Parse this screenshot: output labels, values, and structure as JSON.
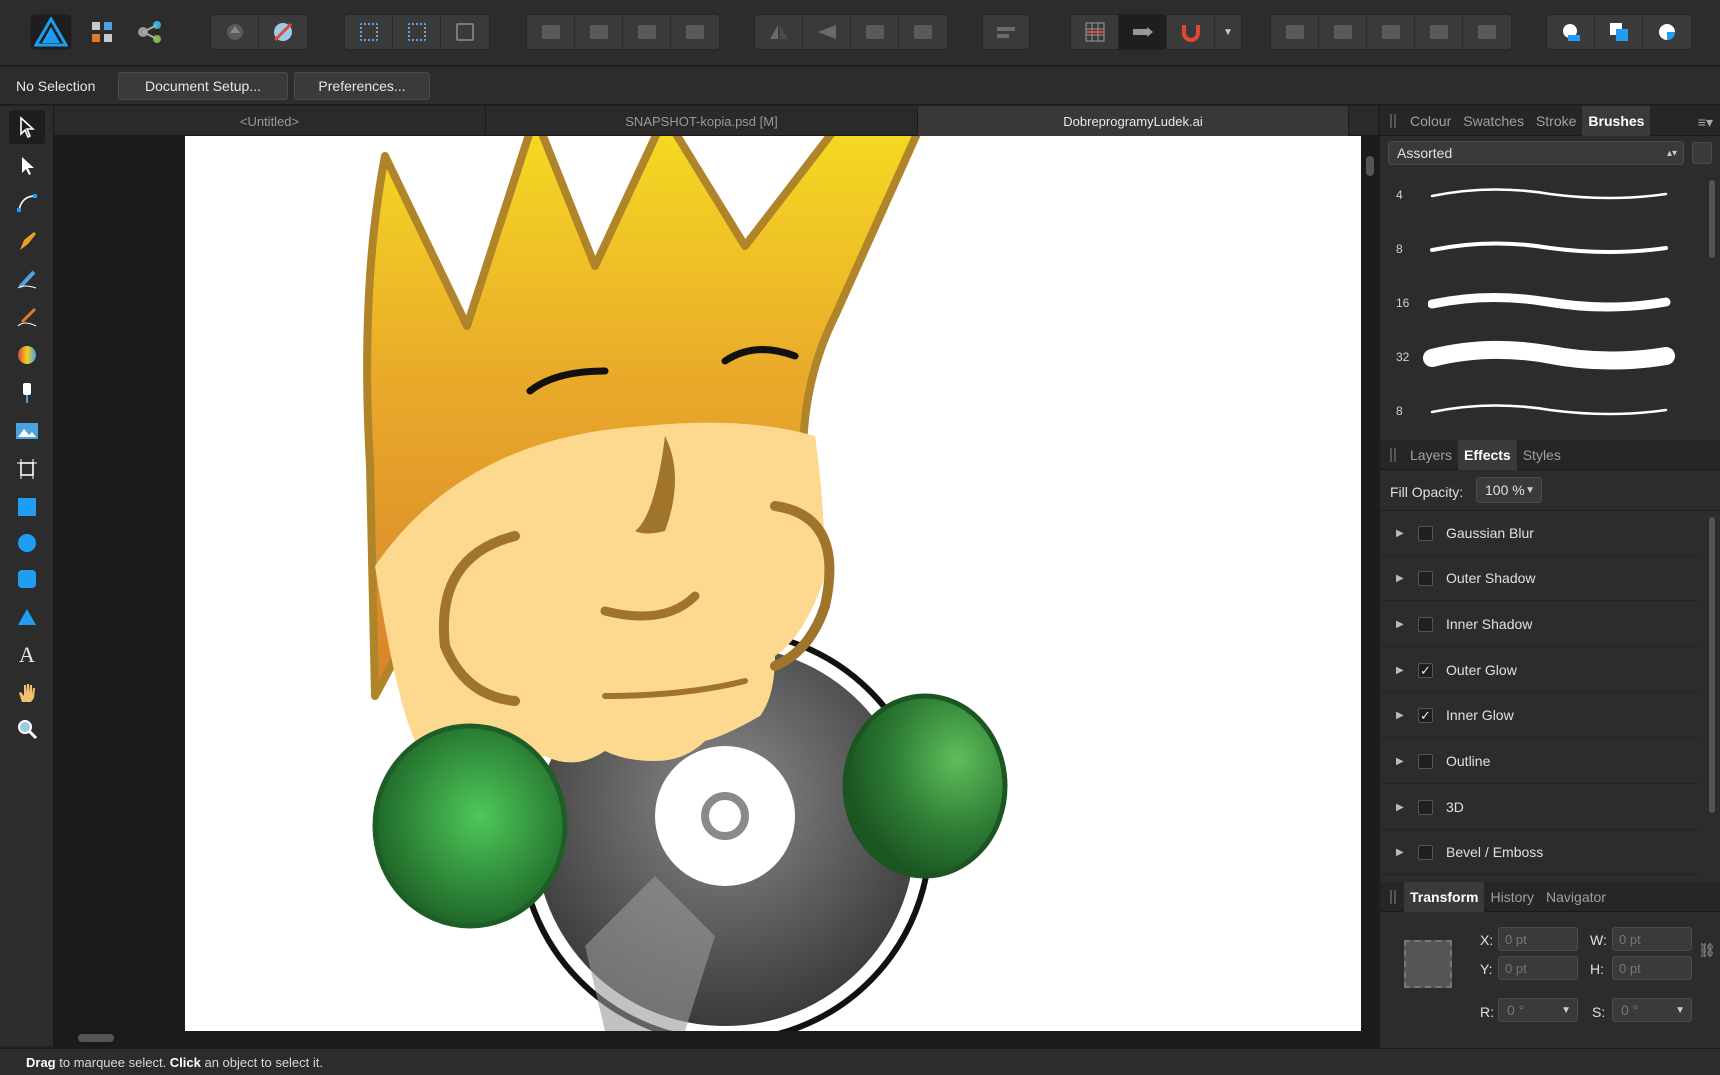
{
  "context": {
    "selection_label": "No Selection",
    "document_setup": "Document Setup...",
    "preferences": "Preferences..."
  },
  "tabs": [
    "<Untitled>",
    "SNAPSHOT-kopia.psd [M]",
    "DobreprogramyLudek.ai"
  ],
  "brushes_panel": {
    "tabs": [
      "Colour",
      "Swatches",
      "Stroke",
      "Brushes"
    ],
    "category": "Assorted",
    "brush_sizes": [
      "4",
      "8",
      "16",
      "32",
      "8"
    ]
  },
  "effects_panel": {
    "tabs": [
      "Layers",
      "Effects",
      "Styles"
    ],
    "fill_opacity_label": "Fill Opacity:",
    "fill_opacity_value": "100 %",
    "effects": [
      {
        "label": "Gaussian Blur",
        "checked": false
      },
      {
        "label": "Outer Shadow",
        "checked": false
      },
      {
        "label": "Inner Shadow",
        "checked": false
      },
      {
        "label": "Outer Glow",
        "checked": true
      },
      {
        "label": "Inner Glow",
        "checked": true
      },
      {
        "label": "Outline",
        "checked": false
      },
      {
        "label": "3D",
        "checked": false
      },
      {
        "label": "Bevel / Emboss",
        "checked": false
      }
    ]
  },
  "transform_panel": {
    "tabs": [
      "Transform",
      "History",
      "Navigator"
    ],
    "x_label": "X:",
    "x_value": "0 pt",
    "y_label": "Y:",
    "y_value": "0 pt",
    "w_label": "W:",
    "w_value": "0 pt",
    "h_label": "H:",
    "h_value": "0 pt",
    "r_label": "R:",
    "r_value": "0 °",
    "s_label": "S:",
    "s_value": "0 °"
  },
  "status": {
    "drag": "Drag",
    "drag_text": " to marquee select. ",
    "click": "Click",
    "click_text": " an object to select it."
  },
  "colors": {
    "accent": "#1e9df2",
    "crown_top": "#f4d820",
    "crown_bottom": "#d98a2c",
    "face": "#fcd98e",
    "glove": "#2f8a3a"
  }
}
